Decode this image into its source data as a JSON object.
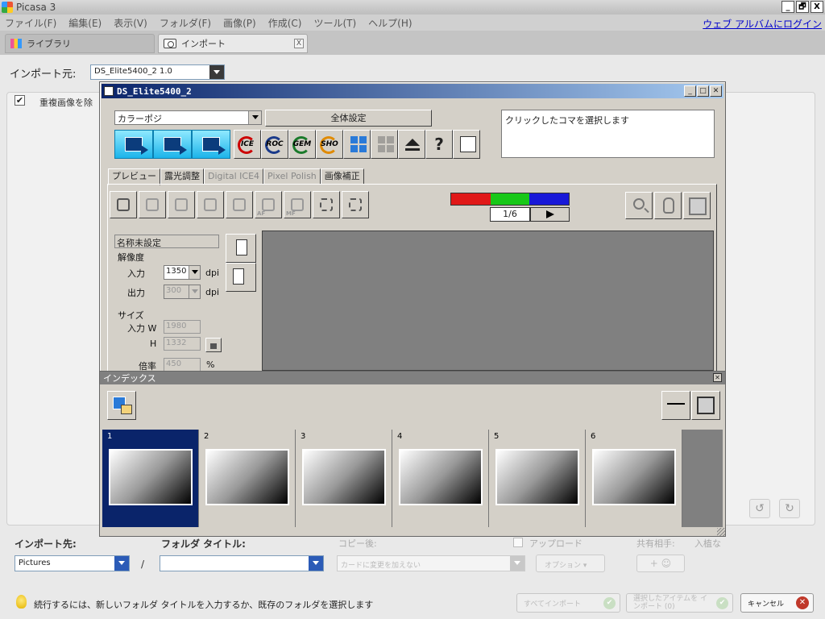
{
  "app": {
    "title": "Picasa 3",
    "login_link": "ウェブ アルバムにログイン",
    "window_buttons": [
      "_",
      "🗗",
      "X"
    ]
  },
  "menu": [
    "ファイル(F)",
    "編集(E)",
    "表示(V)",
    "フォルダ(F)",
    "画像(P)",
    "作成(C)",
    "ツール(T)",
    "ヘルプ(H)"
  ],
  "tabs": {
    "library": "ライブラリ",
    "import": "インポート",
    "close": "X"
  },
  "import": {
    "source_label": "インポート元:",
    "source_value": "DS_Elite5400_2 1.0",
    "duplicate_label": "重複画像を除",
    "duplicate_checked": "✔",
    "dest_label": "インポート先:",
    "dest_value": "Pictures",
    "slash": "/",
    "folder_title_label": "フォルダ タイトル:",
    "copy_label": "コピー後:",
    "copy_value": "カードに変更を加えない",
    "upload_label": "アップロード",
    "share_label": "共有相手:",
    "nobody_label": "入植な",
    "options_label": "オプション",
    "hint": "続行するには、新しいフォルダ タイトルを入力するか、既存のフォルダを選択します",
    "btn_import_all": "すべてインポート",
    "btn_import_selected": "選択したアイテムを インポート (0)",
    "btn_cancel": "キャンセル"
  },
  "scanner": {
    "title": "DS_Elite5400_2",
    "mode_value": "カラーポジ",
    "all_settings": "全体設定",
    "message": "クリックしたコマを選択します",
    "toolbar_labels": [
      "ICE",
      "ROC",
      "GEM",
      "SHO",
      "?"
    ],
    "subtabs": [
      "プレビュー",
      "露光調整",
      "Digital ICE4",
      "Pixel Polish",
      "画像補正"
    ],
    "counter": "1/6",
    "af_label": "AF",
    "mf_label": "MF",
    "name": "名称未設定",
    "resolution_label": "解像度",
    "input_label": "入力",
    "input_dpi": "1350",
    "output_label": "出力",
    "output_dpi": "300",
    "dpi_unit": "dpi",
    "size_label": "サイズ",
    "size_w_label": "入力 W",
    "size_w": "1980",
    "size_h_label": "H",
    "size_h": "1332",
    "scale_label": "倍率",
    "scale_value": "450",
    "percent": "%",
    "rgb_colors": [
      "#e01818",
      "#18c818",
      "#1818d8"
    ]
  },
  "index": {
    "title": "インデックス",
    "frames": [
      "1",
      "2",
      "3",
      "4",
      "5",
      "6"
    ],
    "selected_frame": 1
  }
}
